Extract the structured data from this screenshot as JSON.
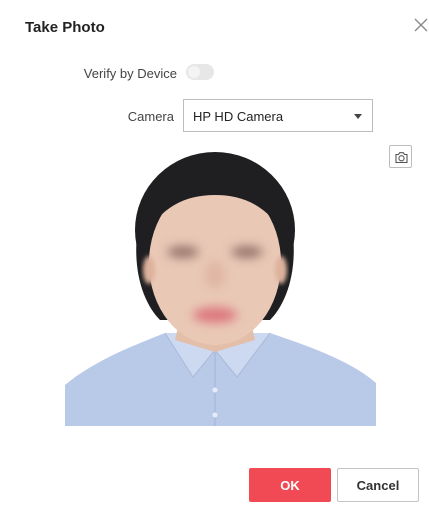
{
  "dialog": {
    "title": "Take Photo",
    "close_icon": "close-icon"
  },
  "verify": {
    "label": "Verify by Device",
    "enabled": false
  },
  "camera": {
    "label": "Camera",
    "selected": "HP HD Camera"
  },
  "capture": {
    "icon": "camera-icon"
  },
  "preview": {
    "description_colors": {
      "hair": "#1f1f22",
      "skin": "#e9c8b6",
      "shirt": "#b9c9e8",
      "background": "#ffffff"
    }
  },
  "buttons": {
    "ok_label": "OK",
    "cancel_label": "Cancel"
  },
  "colors": {
    "accent": "#f24a55",
    "border": "#bdbdbd"
  }
}
